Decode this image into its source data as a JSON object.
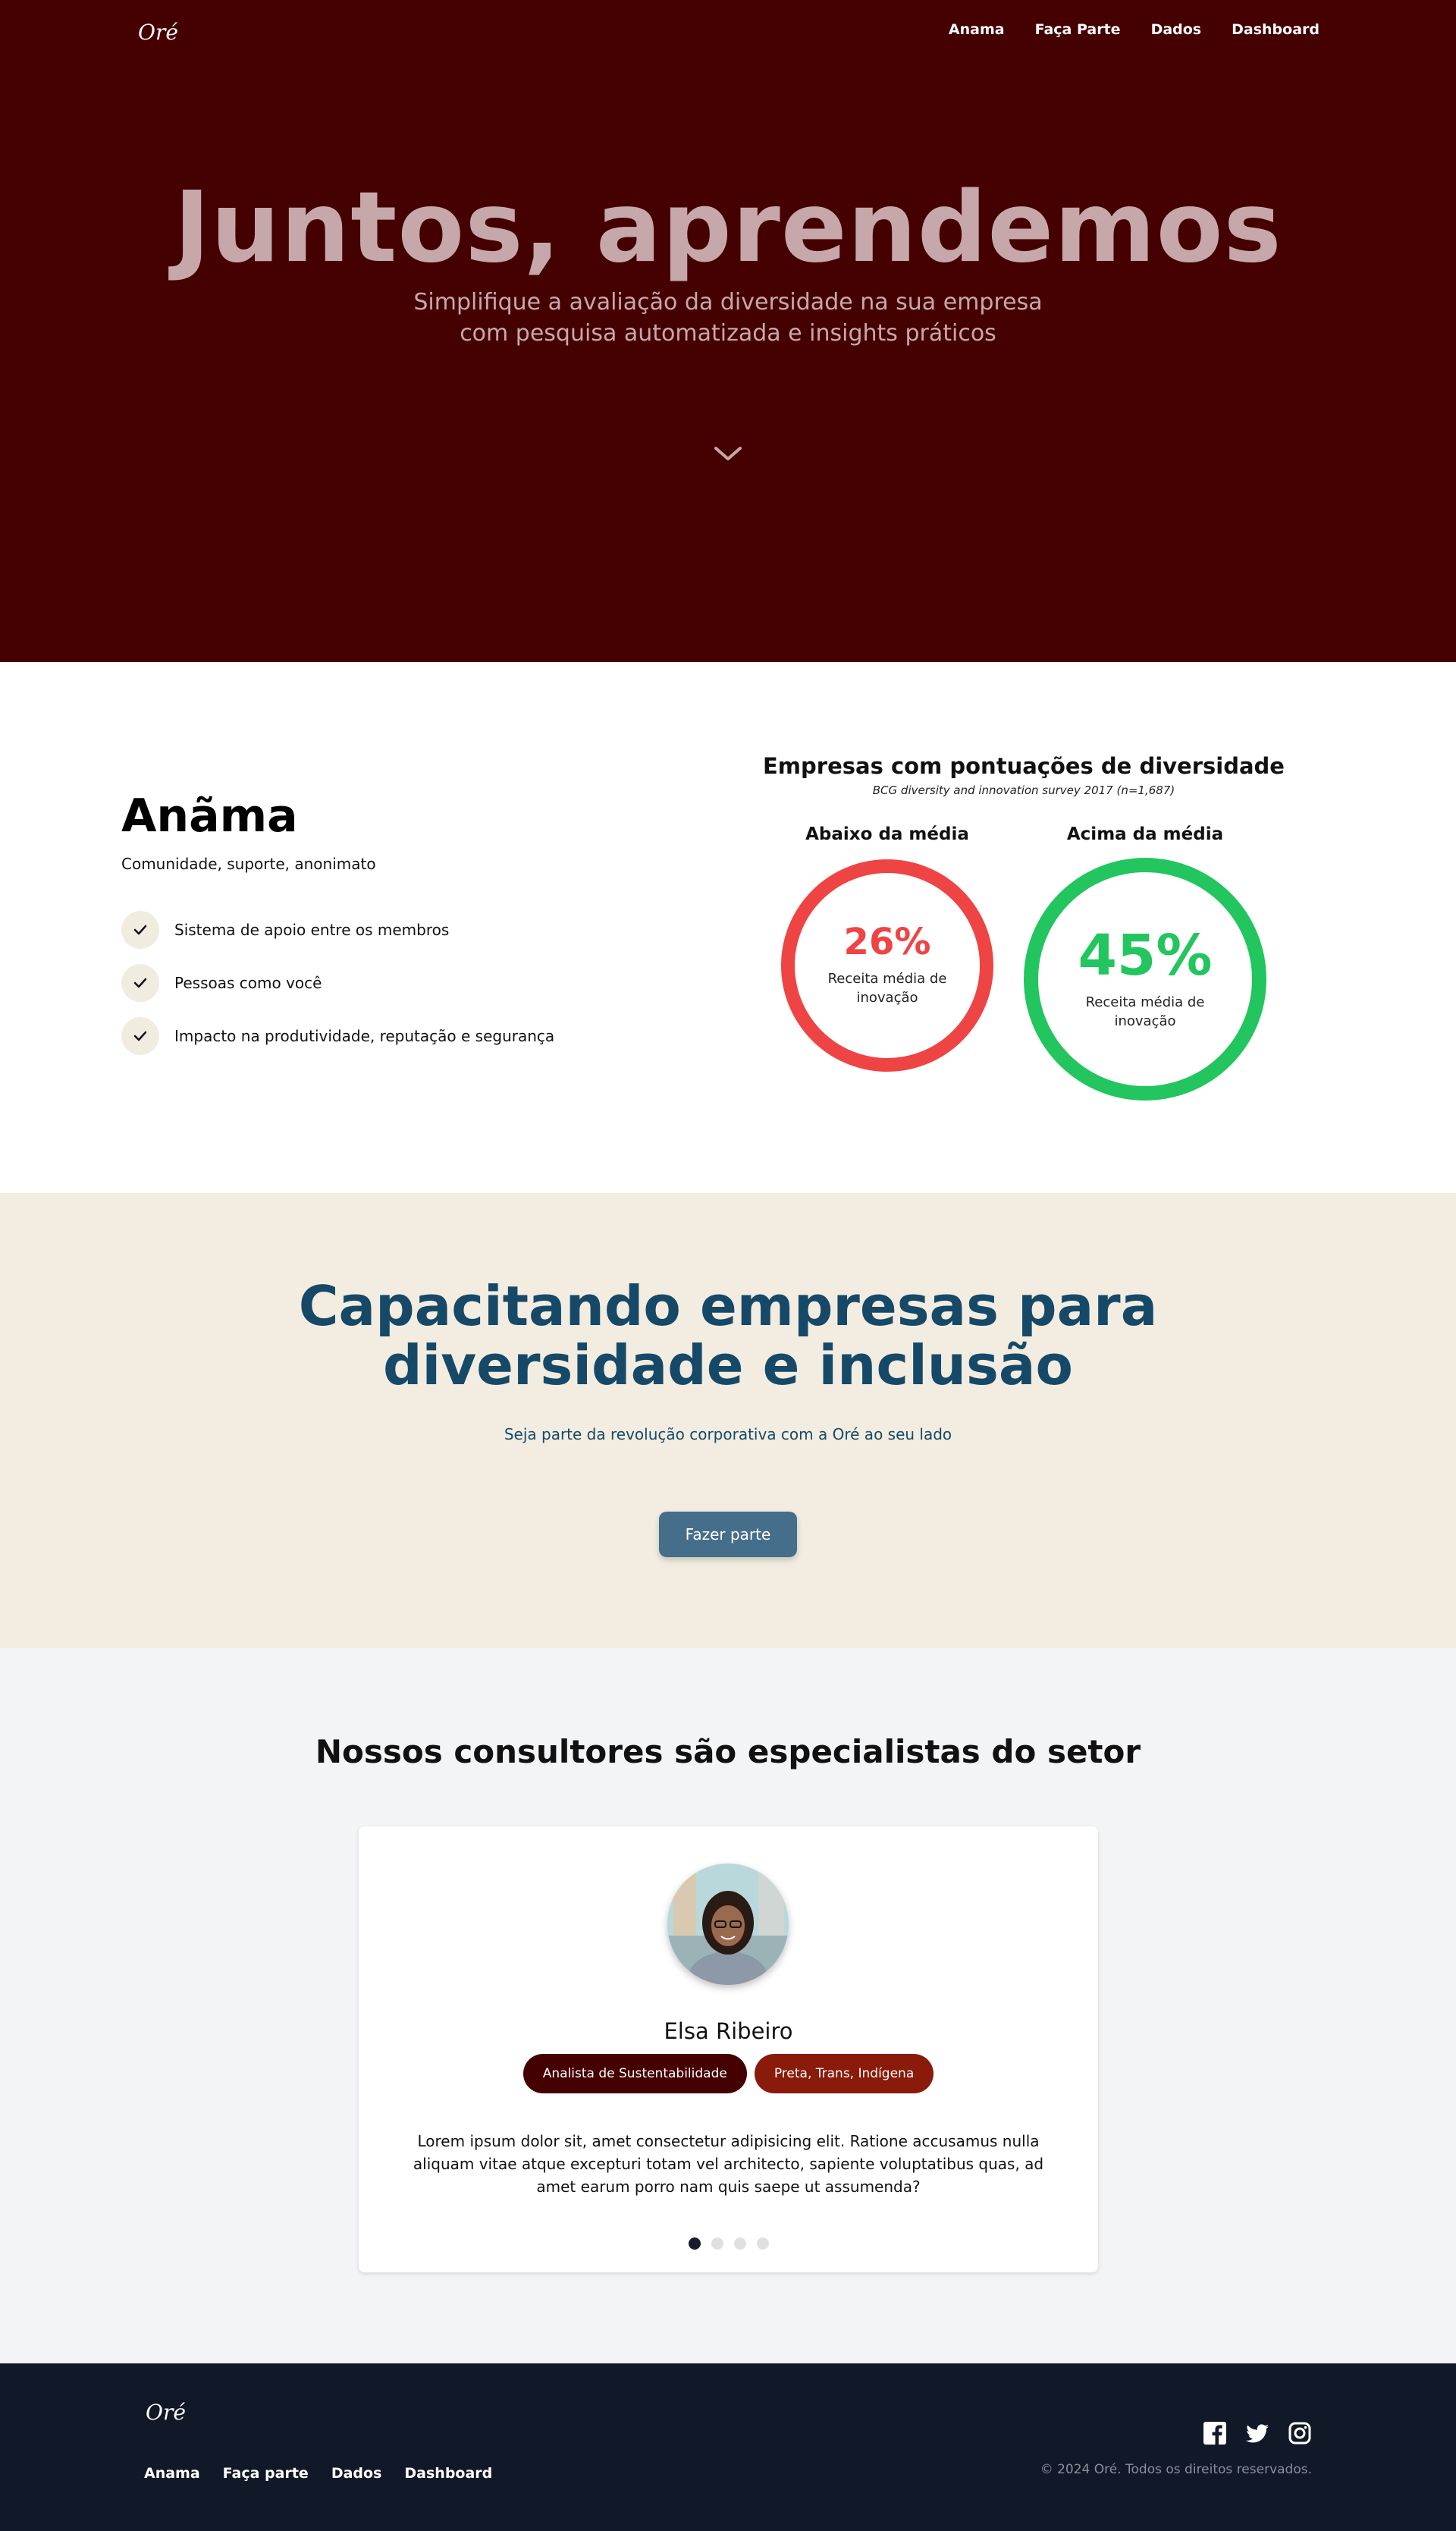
{
  "brand": {
    "logo": "Oré"
  },
  "nav": {
    "items": [
      "Anama",
      "Faça Parte",
      "Dados",
      "Dashboard"
    ]
  },
  "hero": {
    "title": "Juntos, aprendemos",
    "subtitle_line1": "Simplifique a avaliação da diversidade na sua empresa",
    "subtitle_line2": "com pesquisa automatizada e insights práticos",
    "scroll_icon": "chevron-down-icon"
  },
  "anama": {
    "title": "Anãma",
    "tagline": "Comunidade, suporte, anonimato",
    "features": [
      "Sistema de apoio entre os membros",
      "Pessoas como você",
      "Impacto na produtividade, reputação e segurança"
    ]
  },
  "chart_data": {
    "type": "pie",
    "title": "Empresas com pontuações de diversidade",
    "subtitle": "BCG diversity and innovation survey 2017 (n=1,687)",
    "series": [
      {
        "name": "Abaixo da média",
        "value": 26,
        "display": "26%",
        "label": "Receita média de inovação",
        "color": "#ef4444"
      },
      {
        "name": "Acima da média",
        "value": 45,
        "display": "45%",
        "label": "Receita média de inovação",
        "color": "#22c55e"
      }
    ]
  },
  "cta": {
    "title_line1": "Capacitando empresas para",
    "title_line2": "diversidade e inclusão",
    "subtitle": "Seja parte da revolução corporativa com a Oré ao seu lado",
    "button": "Fazer parte"
  },
  "consultants": {
    "title": "Nossos consultores são especialistas do setor",
    "card": {
      "name": "Elsa Ribeiro",
      "badges": [
        "Analista de Sustentabilidade",
        "Preta, Trans, Indígena"
      ],
      "bio": "Lorem ipsum dolor sit, amet consectetur adipisicing elit. Ratione accusamus nulla aliquam vitae atque excepturi totam vel architecto, sapiente voluptatibus quas, ad amet earum porro nam quis saepe ut assumenda?"
    },
    "carousel": {
      "count": 4,
      "active": 1
    }
  },
  "footer": {
    "nav": [
      "Anama",
      "Faça parte",
      "Dados",
      "Dashboard"
    ],
    "social_icons": [
      "facebook-icon",
      "twitter-icon",
      "instagram-icon"
    ],
    "copyright": "© 2024 Oré. Todos os direitos reservados."
  },
  "colors": {
    "hero_bg": "#450001",
    "accent_red": "#ef4444",
    "accent_green": "#22c55e",
    "cta_bg": "#f2ede0",
    "cta_text": "#164968",
    "button": "#456e8b",
    "footer_bg": "#111827"
  }
}
